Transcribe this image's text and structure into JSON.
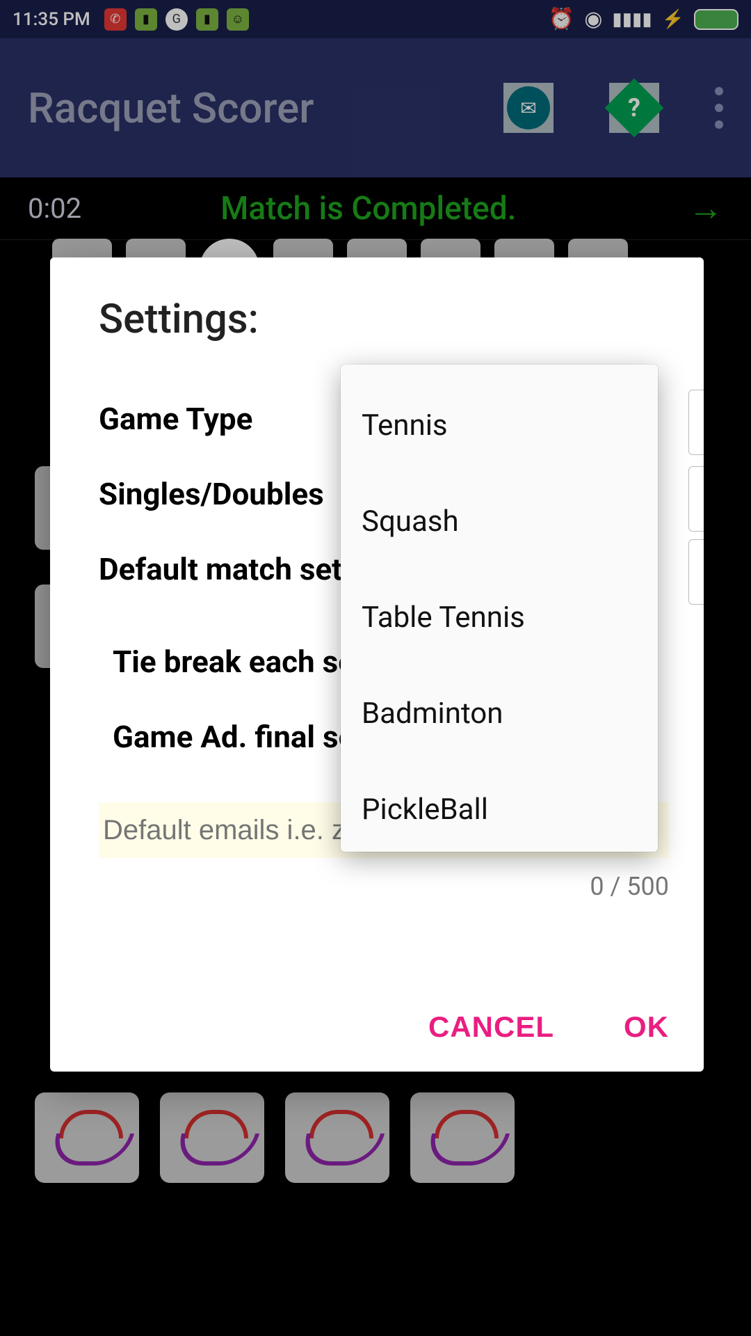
{
  "status": {
    "time": "11:35 PM"
  },
  "app": {
    "title": "Racquet Scorer"
  },
  "sub": {
    "timer": "0:02",
    "match_status": "Match is Completed."
  },
  "dialog": {
    "title": "Settings:",
    "rows": {
      "game_type": "Game Type",
      "singles_doubles": "Singles/Doubles",
      "default_sets": "Default match sets",
      "tie_break": "Tie break each set",
      "game_ad": "Game Ad. final set"
    },
    "email_placeholder": "Default emails i.e. zx",
    "char_count": "0 / 500",
    "cancel": "CANCEL",
    "ok": "OK"
  },
  "dropdown": {
    "options": [
      "Tennis",
      "Squash",
      "Table Tennis",
      "Badminton",
      "PickleBall"
    ]
  }
}
